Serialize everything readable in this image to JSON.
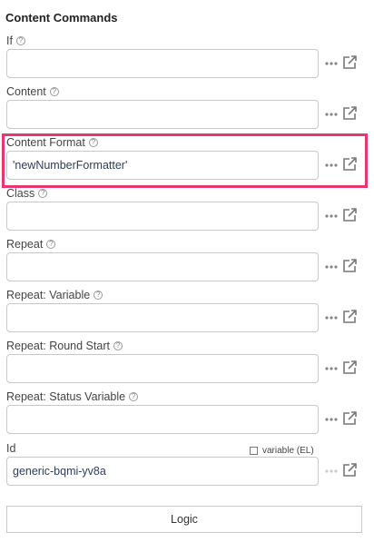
{
  "section_title": "Content Commands",
  "help_glyph": "?",
  "fields": [
    {
      "label": "If",
      "value": ""
    },
    {
      "label": "Content",
      "value": ""
    },
    {
      "label": "Content Format",
      "value": "'newNumberFormatter'"
    },
    {
      "label": "Class",
      "value": ""
    },
    {
      "label": "Repeat",
      "value": ""
    },
    {
      "label": "Repeat: Variable",
      "value": ""
    },
    {
      "label": "Repeat: Round Start",
      "value": ""
    },
    {
      "label": "Repeat: Status Variable",
      "value": ""
    },
    {
      "label": "Id",
      "value": "generic-bqmi-yv8a"
    }
  ],
  "id_el_toggle": {
    "label": "variable (EL)",
    "checked": false
  },
  "logic_button": {
    "label": "Logic"
  },
  "highlight_color": "#e8366e",
  "icons": {
    "more": "dots-icon",
    "open": "external-link-icon",
    "help": "help-icon"
  }
}
